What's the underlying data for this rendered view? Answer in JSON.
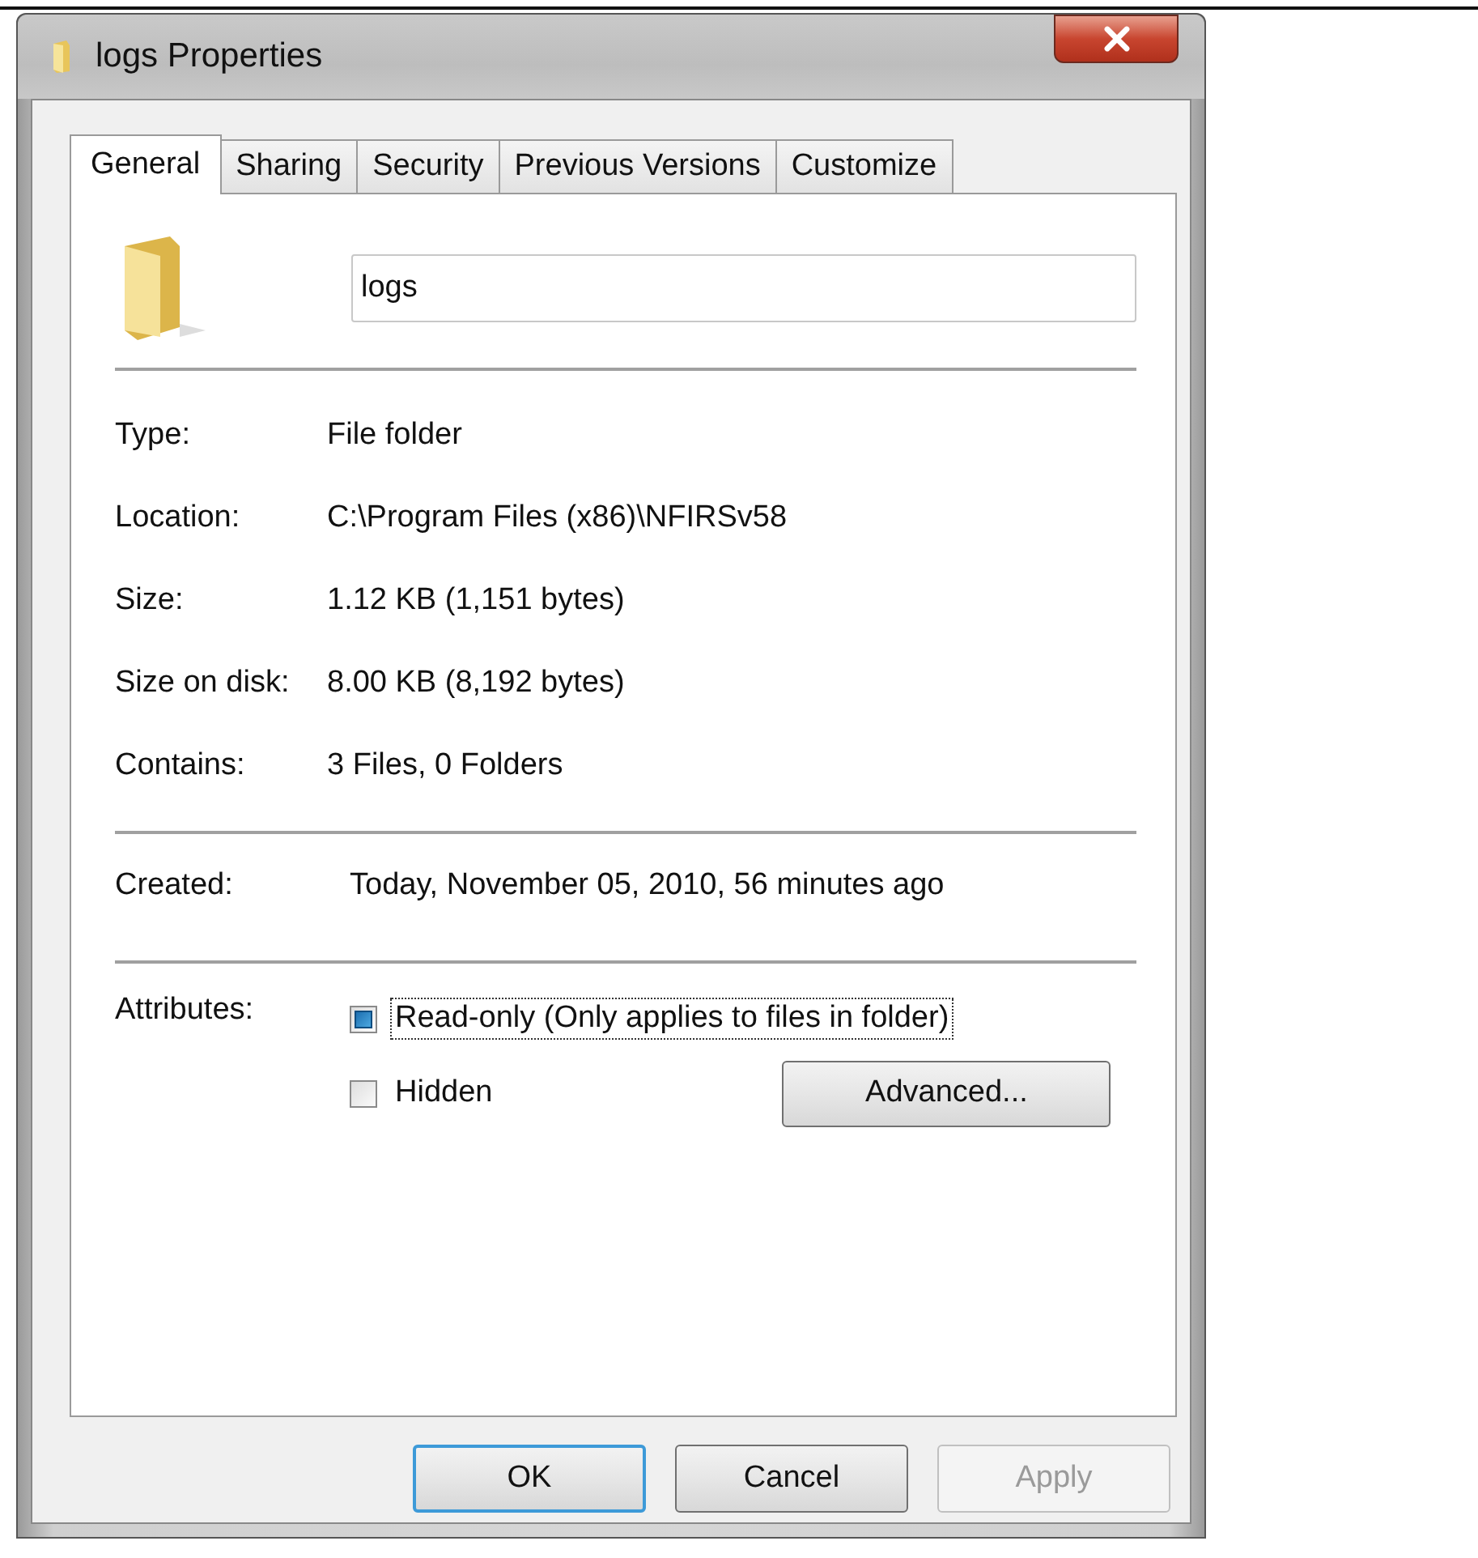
{
  "window": {
    "title": "logs Properties"
  },
  "tabs": [
    {
      "label": "General",
      "selected": true
    },
    {
      "label": "Sharing",
      "selected": false
    },
    {
      "label": "Security",
      "selected": false
    },
    {
      "label": "Previous Versions",
      "selected": false
    },
    {
      "label": "Customize",
      "selected": false
    }
  ],
  "name_field": {
    "value": "logs"
  },
  "info_rows": [
    {
      "label": "Type:",
      "value": "File folder"
    },
    {
      "label": "Location:",
      "value": "C:\\Program Files (x86)\\NFIRSv58"
    },
    {
      "label": "Size:",
      "value": "1.12 KB (1,151 bytes)"
    },
    {
      "label": "Size on disk:",
      "value": "8.00 KB (8,192 bytes)"
    },
    {
      "label": "Contains:",
      "value": "3 Files, 0 Folders"
    }
  ],
  "created": {
    "label": "Created:",
    "value": "Today, November 05, 2010, 56 minutes ago"
  },
  "attributes": {
    "label": "Attributes:",
    "checkboxes": [
      {
        "label": "Read-only (Only applies to files in folder)",
        "checked": false,
        "indeterminate": true,
        "focused": true
      },
      {
        "label": "Hidden",
        "checked": false,
        "indeterminate": false,
        "focused": false
      }
    ],
    "advanced_button": "Advanced..."
  },
  "buttons": [
    {
      "label": "OK",
      "default": true,
      "disabled": false
    },
    {
      "label": "Cancel",
      "default": false,
      "disabled": false
    },
    {
      "label": "Apply",
      "default": false,
      "disabled": true
    }
  ]
}
